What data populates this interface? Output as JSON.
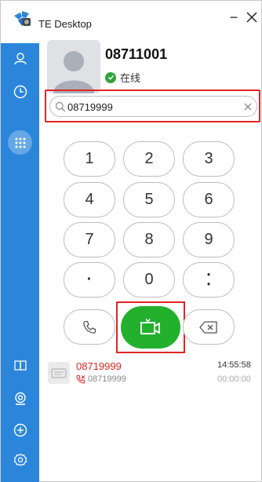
{
  "window": {
    "title": "TE Desktop",
    "minimize_glyph": "−"
  },
  "contact": {
    "number": "08711001",
    "status": "在线"
  },
  "search": {
    "value": "08719999",
    "placeholder": ""
  },
  "keypad": {
    "keys": [
      "1",
      "2",
      "3",
      "4",
      "5",
      "6",
      "7",
      "8",
      "9",
      "·",
      "0",
      "⁚"
    ]
  },
  "history": [
    {
      "name": "08719999",
      "number": "08719999",
      "time": "14:55:58",
      "duration": "00:00:00"
    }
  ],
  "colors": {
    "sidebar": "#2b86db",
    "call": "#22b02d",
    "highlight": "#e02424",
    "online": "#2ea43a"
  },
  "icons": {
    "sidebar_top": [
      "person-icon",
      "clock-icon",
      "dialpad-icon"
    ],
    "sidebar_bottom": [
      "book-icon",
      "webcam-icon",
      "add-circle-icon",
      "settings-icon"
    ],
    "call_row": [
      "phone-icon",
      "video-call-icon",
      "backspace-icon"
    ]
  }
}
